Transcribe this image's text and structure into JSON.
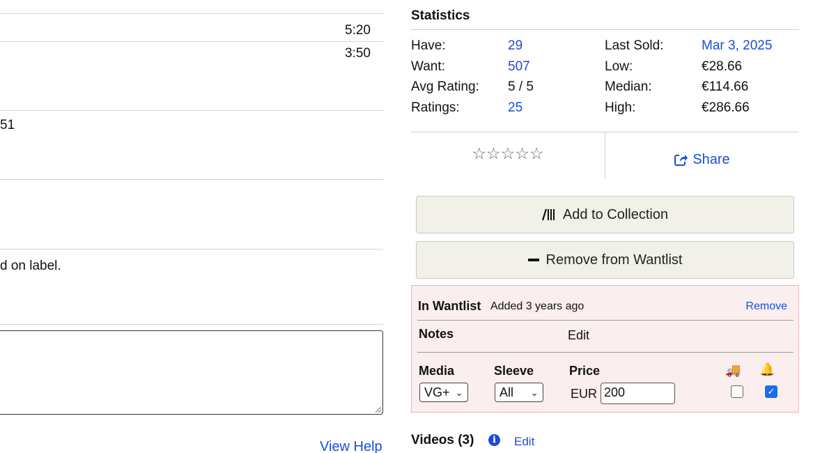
{
  "tracklist": {
    "durations": [
      "5:20",
      "3:50"
    ]
  },
  "left_fragments": {
    "fragment_1": "51",
    "fragment_2": "d on label."
  },
  "help_link": "View Help",
  "statistics": {
    "title": "Statistics",
    "left": [
      {
        "label": "Have:",
        "value": "29",
        "link": true
      },
      {
        "label": "Want:",
        "value": "507",
        "link": true
      },
      {
        "label": "Avg Rating:",
        "value": "5 / 5",
        "link": false
      },
      {
        "label": "Ratings:",
        "value": "25",
        "link": true
      }
    ],
    "right": [
      {
        "label": "Last Sold:",
        "value": "Mar 3, 2025",
        "link": true
      },
      {
        "label": "Low:",
        "value": "€28.66",
        "link": false
      },
      {
        "label": "Median:",
        "value": "€114.66",
        "link": false
      },
      {
        "label": "High:",
        "value": "€286.66",
        "link": false
      }
    ]
  },
  "rating": {
    "stars": "☆☆☆☆☆",
    "filled": 0,
    "max": 5
  },
  "share": {
    "label": "Share",
    "icon": "share-icon"
  },
  "actions": {
    "add_collection": "Add to Collection",
    "remove_wantlist": "Remove from Wantlist"
  },
  "wantlist": {
    "title": "In Wantlist",
    "added": "Added 3 years ago",
    "remove": "Remove",
    "notes_label": "Notes",
    "notes_edit": "Edit",
    "media_label": "Media",
    "media_value": "VG+",
    "sleeve_label": "Sleeve",
    "sleeve_value": "All",
    "price_label": "Price",
    "currency": "EUR",
    "price_value": "200",
    "shipping_icon": "🚚",
    "alert_icon": "🔔",
    "shipping_checked": false,
    "alert_checked": true
  },
  "videos": {
    "label": "Videos (3)",
    "edit": "Edit"
  },
  "colors": {
    "link": "#1a4cd6",
    "button_bg": "#f1f1ea",
    "wantlist_bg": "#fbeeee",
    "checkbox_checked": "#1a6fe8"
  }
}
